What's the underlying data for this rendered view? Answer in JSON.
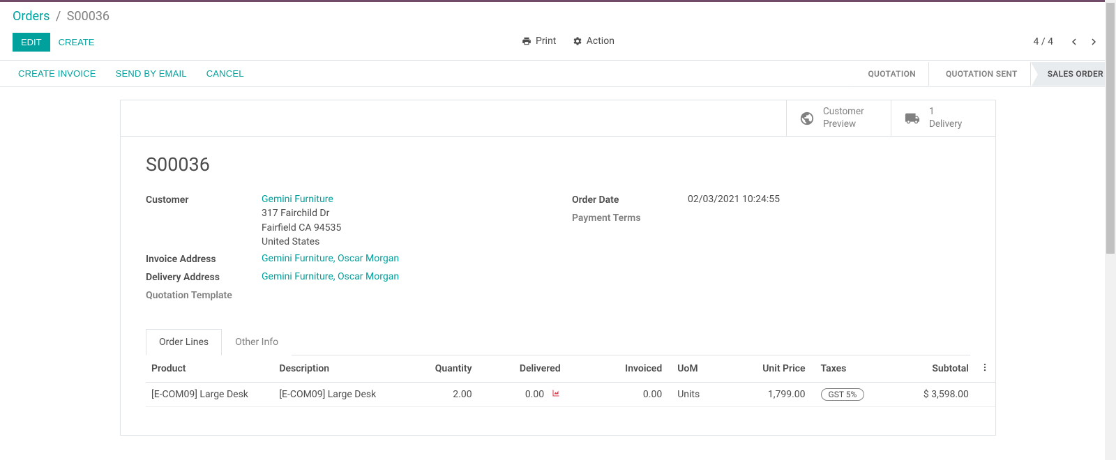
{
  "breadcrumb": {
    "parent": "Orders",
    "current": "S00036"
  },
  "toolbar": {
    "edit": "EDIT",
    "create": "CREATE",
    "print": "Print",
    "action": "Action"
  },
  "pager": {
    "counter": "4 / 4"
  },
  "status_actions": {
    "create_invoice": "CREATE INVOICE",
    "send_email": "SEND BY EMAIL",
    "cancel": "CANCEL"
  },
  "stages": {
    "quotation": "QUOTATION",
    "quotation_sent": "QUOTATION SENT",
    "sales_order": "SALES ORDER"
  },
  "stat_buttons": {
    "preview": {
      "line1": "Customer",
      "line2": "Preview"
    },
    "delivery": {
      "line1": "1",
      "line2": "Delivery"
    }
  },
  "record": {
    "name": "S00036"
  },
  "fields": {
    "customer_label": "Customer",
    "customer_name": "Gemini Furniture",
    "customer_addr1": "317 Fairchild Dr",
    "customer_addr2": "Fairfield CA 94535",
    "customer_addr3": "United States",
    "invoice_label": "Invoice Address",
    "invoice_value": "Gemini Furniture, Oscar Morgan",
    "delivery_label": "Delivery Address",
    "delivery_value": "Gemini Furniture, Oscar Morgan",
    "template_label": "Quotation Template",
    "order_date_label": "Order Date",
    "order_date_value": "02/03/2021 10:24:55",
    "payment_terms_label": "Payment Terms"
  },
  "tabs": {
    "order_lines": "Order Lines",
    "other_info": "Other Info"
  },
  "table": {
    "headers": {
      "product": "Product",
      "description": "Description",
      "quantity": "Quantity",
      "delivered": "Delivered",
      "invoiced": "Invoiced",
      "uom": "UoM",
      "unit_price": "Unit Price",
      "taxes": "Taxes",
      "subtotal": "Subtotal"
    },
    "rows": [
      {
        "product": "[E-COM09] Large Desk",
        "description": "[E-COM09] Large Desk",
        "quantity": "2.00",
        "delivered": "0.00",
        "invoiced": "0.00",
        "uom": "Units",
        "unit_price": "1,799.00",
        "taxes": "GST 5%",
        "subtotal": "$ 3,598.00"
      }
    ]
  }
}
